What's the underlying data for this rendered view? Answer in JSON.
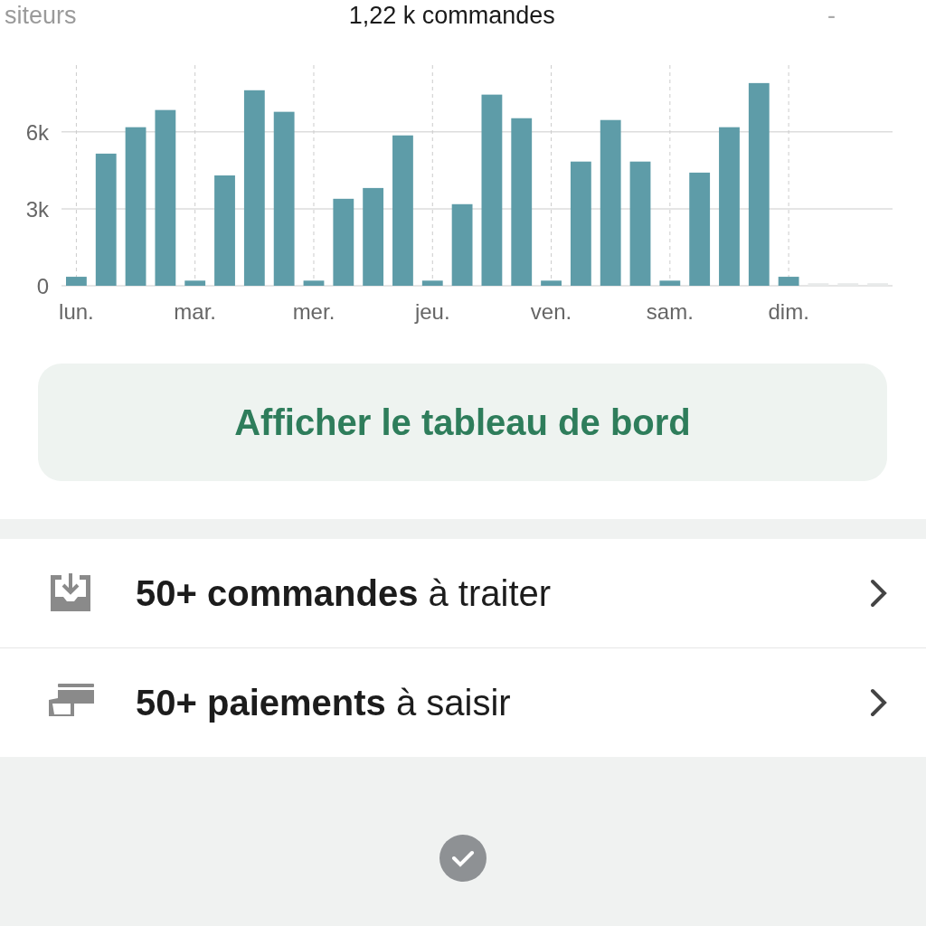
{
  "summary_row": {
    "left": "siteurs",
    "center": "1,22 k commandes",
    "right": "-"
  },
  "chart": {
    "chart_data": {
      "type": "bar",
      "grid": true,
      "categories": [
        "lun.",
        null,
        null,
        null,
        "mar.",
        null,
        null,
        null,
        "mer.",
        null,
        null,
        null,
        "jeu.",
        null,
        null,
        null,
        "ven.",
        null,
        null,
        null,
        "sam.",
        null,
        null,
        null,
        "dim.",
        null,
        null,
        null
      ],
      "series": [
        {
          "color": "#5e9ca8",
          "values": [
            350,
            5150,
            6180,
            6850,
            200,
            4300,
            7620,
            6780,
            200,
            3390,
            3810,
            5860,
            200,
            3180,
            7450,
            6530,
            200,
            4840,
            6460,
            4840,
            200,
            4410,
            6180,
            7900,
            350,
            null,
            null,
            null
          ]
        },
        {
          "color": "#e8eaea",
          "values": [
            null,
            null,
            null,
            null,
            null,
            null,
            null,
            null,
            null,
            null,
            null,
            null,
            null,
            null,
            null,
            null,
            null,
            null,
            null,
            null,
            null,
            null,
            null,
            null,
            null,
            100,
            100,
            100
          ]
        }
      ],
      "ylim": [
        0,
        8600
      ],
      "yticks": [
        {
          "value": 0,
          "label": "0"
        },
        {
          "value": 3000,
          "label": "3k"
        },
        {
          "value": 6000,
          "label": "6k"
        }
      ]
    }
  },
  "dashboard_button": {
    "label": "Afficher le tableau de bord"
  },
  "tasks": [
    {
      "kind": "orders",
      "text": "**50+ commandes** à traiter"
    },
    {
      "kind": "payments",
      "text": "**50+ paiements** à saisir"
    }
  ]
}
